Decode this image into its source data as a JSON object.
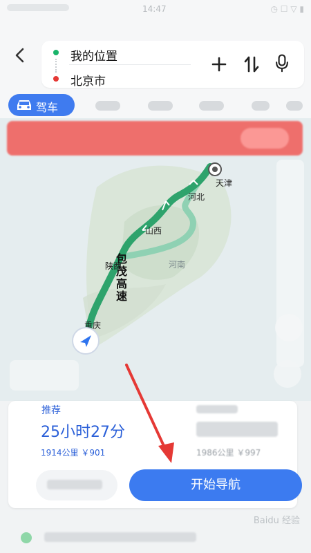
{
  "status": {
    "time": "14:47"
  },
  "route_input": {
    "origin": "我的位置",
    "destination": "北京市"
  },
  "modes": {
    "active_label": "驾车"
  },
  "map": {
    "labels": {
      "tianjin": "天津",
      "hebei": "河北",
      "shanxi": "山西",
      "shaanxi": "陕西",
      "henan": "河南",
      "chongqing": "重庆"
    },
    "route_name_chars": [
      "包",
      "茂",
      "高",
      "速"
    ]
  },
  "route_card": {
    "recommended": {
      "tag": "推荐",
      "duration": "25小时27分",
      "distance_cost": "1914公里 ￥901"
    },
    "alternate": {
      "distance_cost": "1986公里 ￥997"
    },
    "start_button": "开始导航"
  },
  "colors": {
    "accent": "#3c7bf0",
    "route_green": "#2ea36c",
    "alert_red": "#f05a56",
    "arrow_red": "#e53935"
  },
  "watermark": "Baidu 经验"
}
